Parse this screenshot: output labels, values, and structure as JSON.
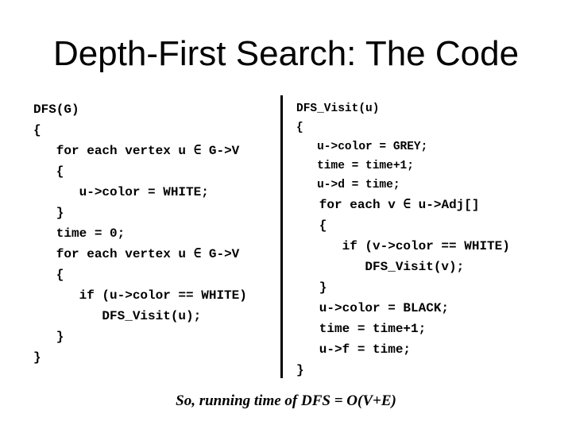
{
  "slide": {
    "title": "Depth-First Search: The Code",
    "left_code": [
      "DFS(G)",
      "{",
      "   for each vertex u ∈ G->V",
      "   {",
      "      u->color = WHITE;",
      "   }",
      "   time = 0;",
      "   for each vertex u ∈ G->V",
      "   {",
      "      if (u->color == WHITE)",
      "         DFS_Visit(u);",
      "   }",
      "}"
    ],
    "right_code": [
      "DFS_Visit(u)",
      "{",
      "   u->color = GREY;",
      "   time = time+1;",
      "   u->d = time;",
      "   for each v ∈ u->Adj[]",
      "   {",
      "      if (v->color == WHITE)",
      "         DFS_Visit(v);",
      "   }",
      "   u->color = BLACK;",
      "   time = time+1;",
      "   u->f = time;",
      "}"
    ],
    "footer": "So, running time of DFS = O(V+E)"
  }
}
